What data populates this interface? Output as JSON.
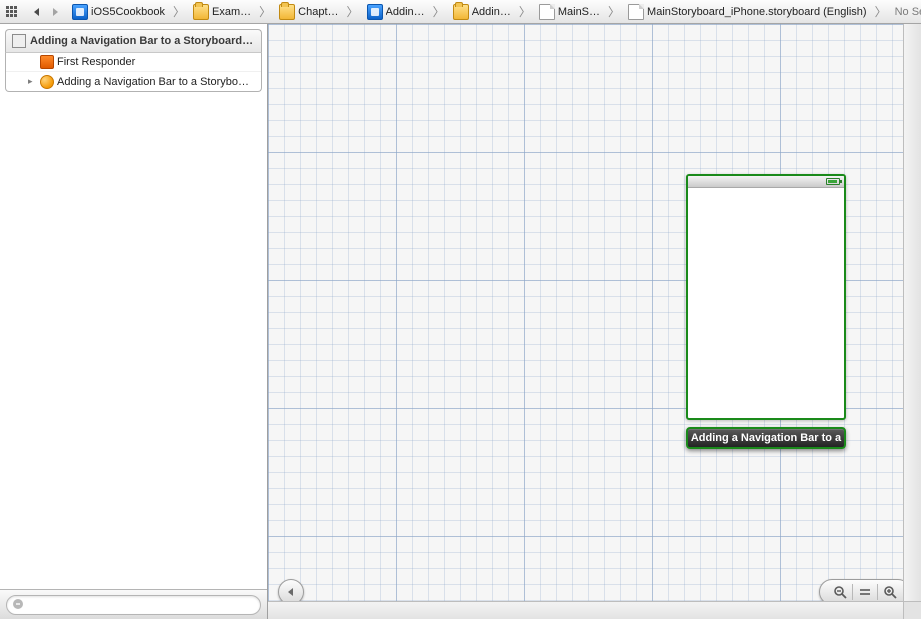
{
  "jumpbar": {
    "crumbs": [
      {
        "icon": "proj",
        "label": "iOS5Cookbook"
      },
      {
        "icon": "folder",
        "label": "Exam…"
      },
      {
        "icon": "folder",
        "label": "Chapt…"
      },
      {
        "icon": "proj",
        "label": "Addin…"
      },
      {
        "icon": "folder",
        "label": "Addin…"
      },
      {
        "icon": "file",
        "label": "MainS…"
      },
      {
        "icon": "file",
        "label": "MainStoryboard_iPhone.storyboard (English)"
      },
      {
        "icon": "",
        "label": "No Selection"
      }
    ]
  },
  "outline": {
    "scene_title": "Adding a Navigation Bar to a Storyboard…",
    "rows": [
      {
        "disclosure": "",
        "icon": "cube",
        "label": "First Responder"
      },
      {
        "disclosure": "▸",
        "icon": "vc",
        "label": "Adding a Navigation Bar to a Storybo…"
      }
    ],
    "filter_placeholder": ""
  },
  "canvas": {
    "scene_caption": "Adding a Navigation Bar to a"
  },
  "icons": {
    "grid": "related-items-icon",
    "back": "back-icon",
    "fwd": "forward-icon",
    "collapse": "collapse-outline-icon",
    "zoom_out": "zoom-out-icon",
    "zoom_fit": "zoom-actual-icon",
    "zoom_in": "zoom-in-icon",
    "filter": "filter-icon"
  }
}
